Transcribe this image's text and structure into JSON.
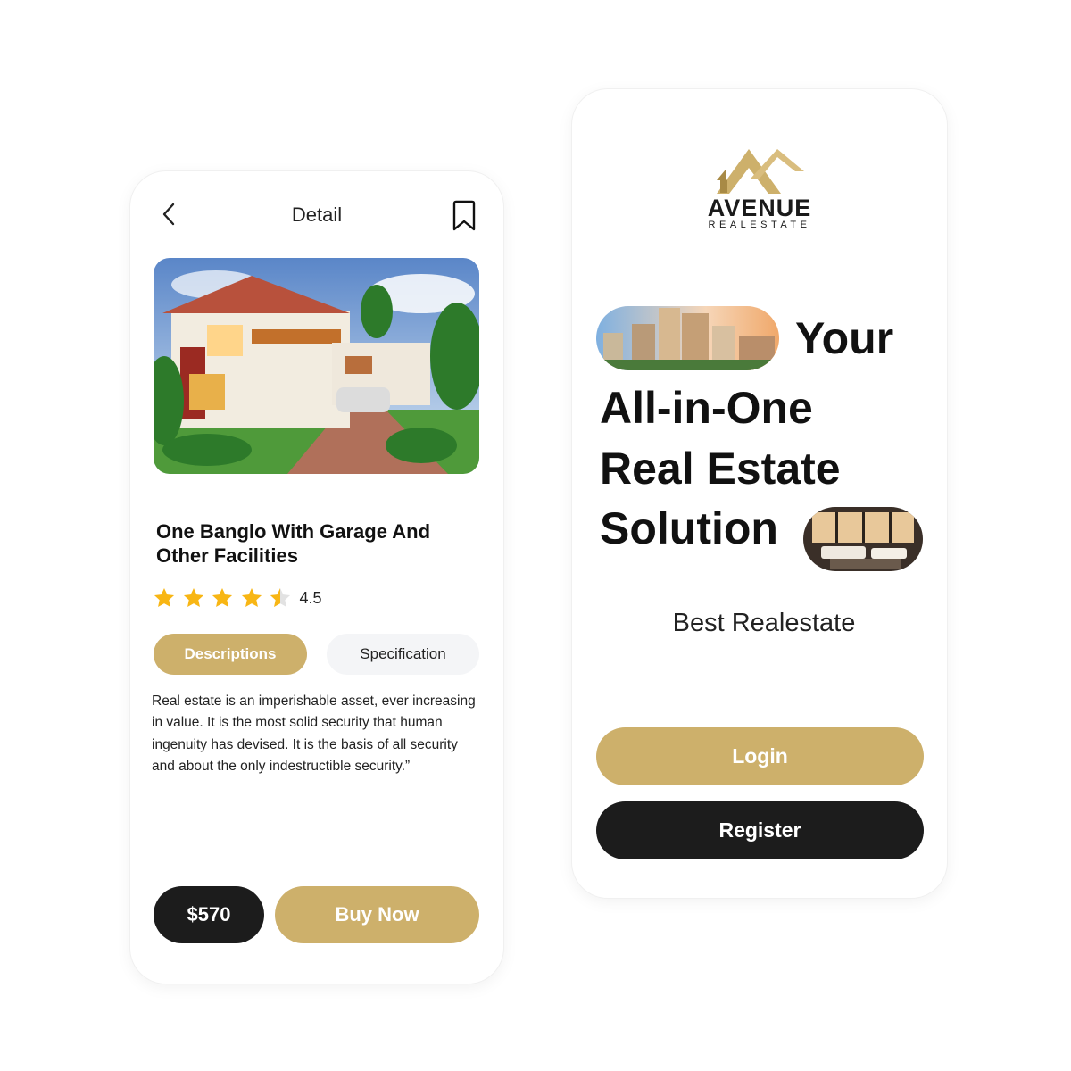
{
  "detail_screen": {
    "header": {
      "title": "Detail",
      "back_icon": "chevron-left-icon",
      "bookmark_icon": "bookmark-icon"
    },
    "property": {
      "title": "One Banglo With Garage And Other Facilities",
      "image": "house-photo",
      "rating": 4.5,
      "rating_label": "4.5",
      "rating_max": 5
    },
    "tabs": [
      {
        "label": "Descriptions",
        "active": true
      },
      {
        "label": "Specification",
        "active": false
      }
    ],
    "description": "Real estate is an imperishable asset, ever increasing in value. It is the most solid security that human ingenuity has devised. It is the basis of all security and about the only indestructible security.”",
    "footer": {
      "price": "$570",
      "buy_label": "Buy Now"
    }
  },
  "welcome_screen": {
    "logo": {
      "name": "AVENUE",
      "sub": "REALESTATE"
    },
    "headline": {
      "line1": "Your",
      "line2": "All-in-One",
      "line3": "Real Estate",
      "line4": "Solution"
    },
    "tagline": "Best Realestate",
    "login_label": "Login",
    "register_label": "Register"
  },
  "colors": {
    "accent_gold": "#cdb06b",
    "dark": "#1c1c1c",
    "star": "#f8b614",
    "tab_inactive_bg": "#f4f5f7"
  }
}
